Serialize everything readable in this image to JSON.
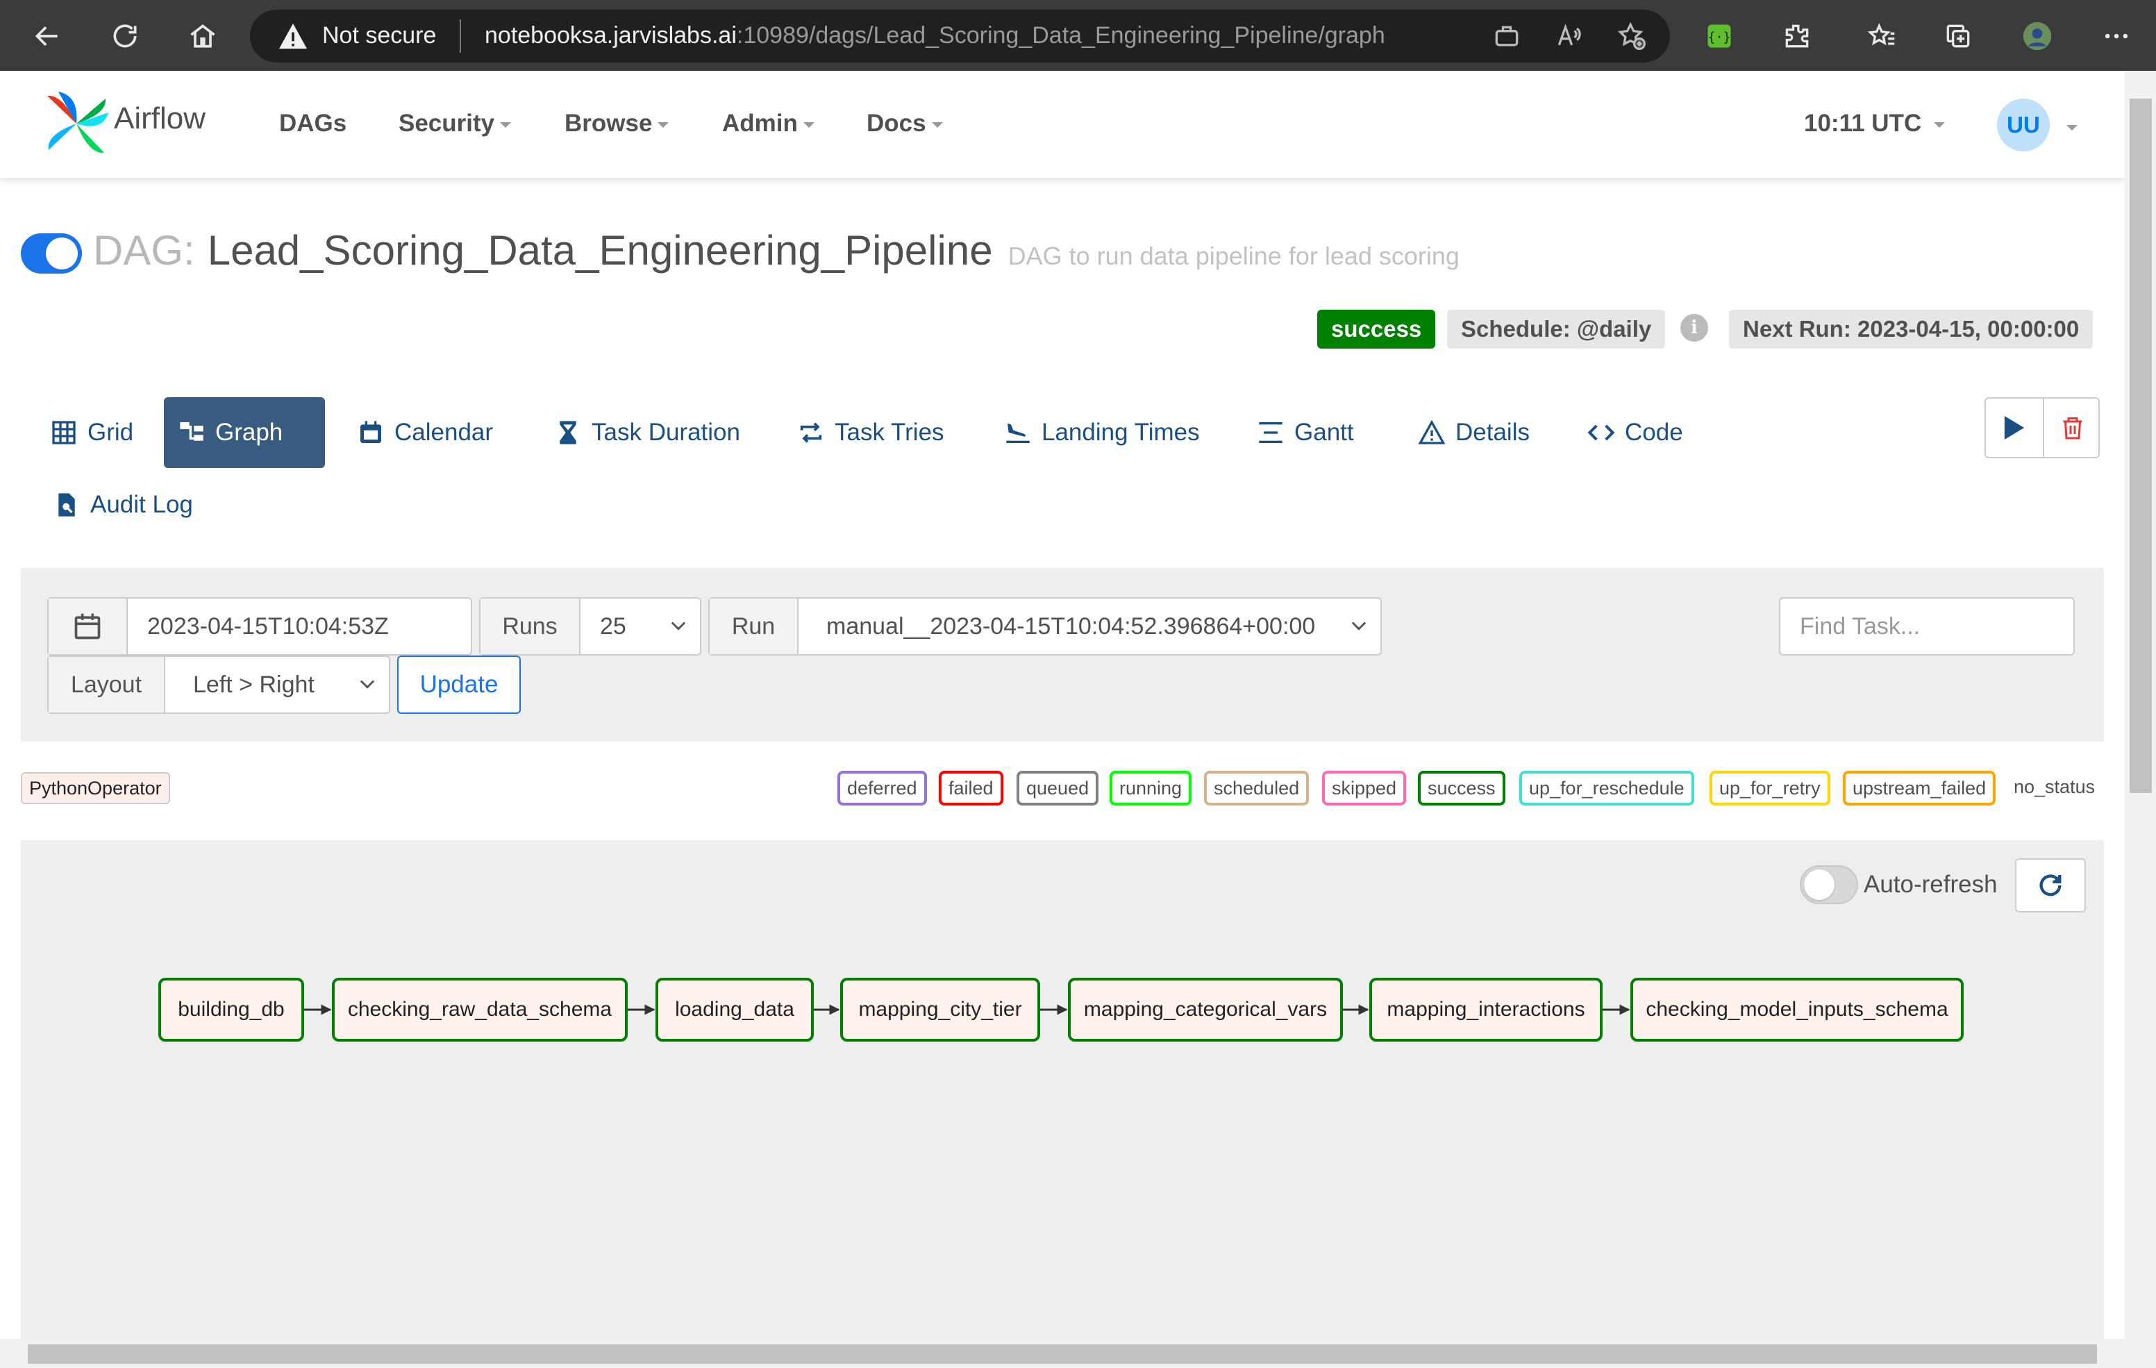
{
  "browser": {
    "security_label": "Not secure",
    "url_host": "notebooksa.jarvislabs.ai",
    "url_path": ":10989/dags/Lead_Scoring_Data_Engineering_Pipeline/graph"
  },
  "navbar": {
    "brand": "Airflow",
    "items": [
      {
        "label": "DAGs",
        "dropdown": false
      },
      {
        "label": "Security",
        "dropdown": true
      },
      {
        "label": "Browse",
        "dropdown": true
      },
      {
        "label": "Admin",
        "dropdown": true
      },
      {
        "label": "Docs",
        "dropdown": true
      }
    ],
    "clock": "10:11 UTC",
    "user_initials": "UU"
  },
  "dag": {
    "prefix": "DAG:",
    "name": "Lead_Scoring_Data_Engineering_Pipeline",
    "description": "DAG to run data pipeline for lead scoring",
    "state": "success",
    "schedule": "Schedule: @daily",
    "next_run": "Next Run: 2023-04-15, 00:00:00"
  },
  "tabs": [
    {
      "label": "Grid",
      "icon": "grid-icon",
      "active": false
    },
    {
      "label": "Graph",
      "icon": "graph-icon",
      "active": true
    },
    {
      "label": "Calendar",
      "icon": "calendar-icon",
      "active": false
    },
    {
      "label": "Task Duration",
      "icon": "hourglass-icon",
      "active": false
    },
    {
      "label": "Task Tries",
      "icon": "repeat-icon",
      "active": false
    },
    {
      "label": "Landing Times",
      "icon": "plane-landing-icon",
      "active": false
    },
    {
      "label": "Gantt",
      "icon": "gantt-icon",
      "active": false
    },
    {
      "label": "Details",
      "icon": "warning-triangle-icon",
      "active": false
    },
    {
      "label": "Code",
      "icon": "code-icon",
      "active": false
    },
    {
      "label": "Audit Log",
      "icon": "file-search-icon",
      "active": false
    }
  ],
  "filters": {
    "base_date": "2023-04-15T10:04:53Z",
    "runs_label": "Runs",
    "runs_value": "25",
    "run_label": "Run",
    "run_value": "manual__2023-04-15T10:04:52.396864+00:00",
    "layout_label": "Layout",
    "layout_value": "Left > Right",
    "update_label": "Update",
    "find_placeholder": "Find Task..."
  },
  "legend": {
    "operator": "PythonOperator",
    "operator_color": "#ffefeb",
    "states": [
      {
        "label": "deferred",
        "color": "#9370db"
      },
      {
        "label": "failed",
        "color": "#ff0000"
      },
      {
        "label": "queued",
        "color": "#808080"
      },
      {
        "label": "running",
        "color": "#00ff00"
      },
      {
        "label": "scheduled",
        "color": "#d2b48c"
      },
      {
        "label": "skipped",
        "color": "#ff69b4"
      },
      {
        "label": "success",
        "color": "#008000"
      },
      {
        "label": "up_for_reschedule",
        "color": "#40e0d0"
      },
      {
        "label": "up_for_retry",
        "color": "#ffd700"
      },
      {
        "label": "upstream_failed",
        "color": "#ffa500"
      }
    ],
    "no_status": "no_status"
  },
  "graph": {
    "auto_refresh_label": "Auto-refresh",
    "auto_refresh_on": false,
    "tasks": [
      {
        "id": "building_db",
        "state": "success"
      },
      {
        "id": "checking_raw_data_schema",
        "state": "success"
      },
      {
        "id": "loading_data",
        "state": "success"
      },
      {
        "id": "mapping_city_tier",
        "state": "success"
      },
      {
        "id": "mapping_categorical_vars",
        "state": "success"
      },
      {
        "id": "mapping_interactions",
        "state": "success"
      },
      {
        "id": "checking_model_inputs_schema",
        "state": "success"
      }
    ]
  },
  "colors": {
    "accent": "#017cee",
    "active_tab": "#375c80",
    "success": "#008000",
    "chrome": "#3b3b3b"
  }
}
